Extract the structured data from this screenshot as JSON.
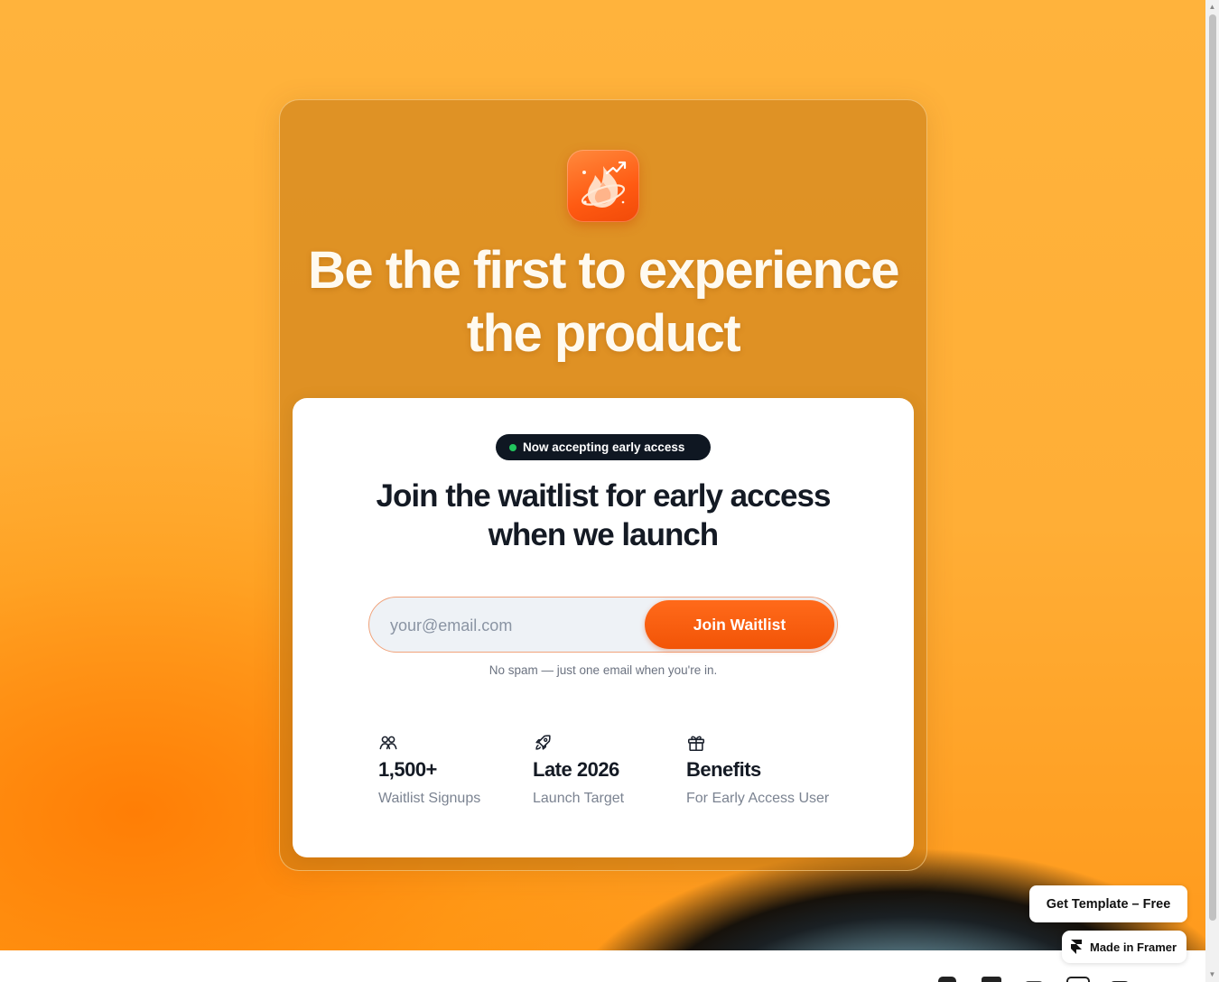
{
  "hero": {
    "logo_icon": "flame-chart-logo-icon",
    "title": "Be the first to experience the product"
  },
  "waitlist": {
    "badge": {
      "text": "Now accepting early access",
      "dot_color": "#22c55e"
    },
    "title": "Join the waitlist for early access when we launch",
    "email_placeholder": "your@email.com",
    "email_value": "",
    "button_label": "Join Waitlist",
    "note": "No spam — just one email when you're in."
  },
  "stats": [
    {
      "icon": "users-icon",
      "value": "1,500+",
      "label": "Waitlist Signups"
    },
    {
      "icon": "rocket-icon",
      "value": "Late 2026",
      "label": "Launch Target"
    },
    {
      "icon": "gift-icon",
      "value": "Benefits",
      "label": "For Early Access User"
    }
  ],
  "overlay": {
    "get_template_label": "Get Template – Free",
    "made_in_framer_label": "Made in Framer"
  },
  "colors": {
    "accent": "#f25407",
    "background": "#ffae36",
    "badge_bg": "#0f1722",
    "text_dark": "#141a24"
  }
}
